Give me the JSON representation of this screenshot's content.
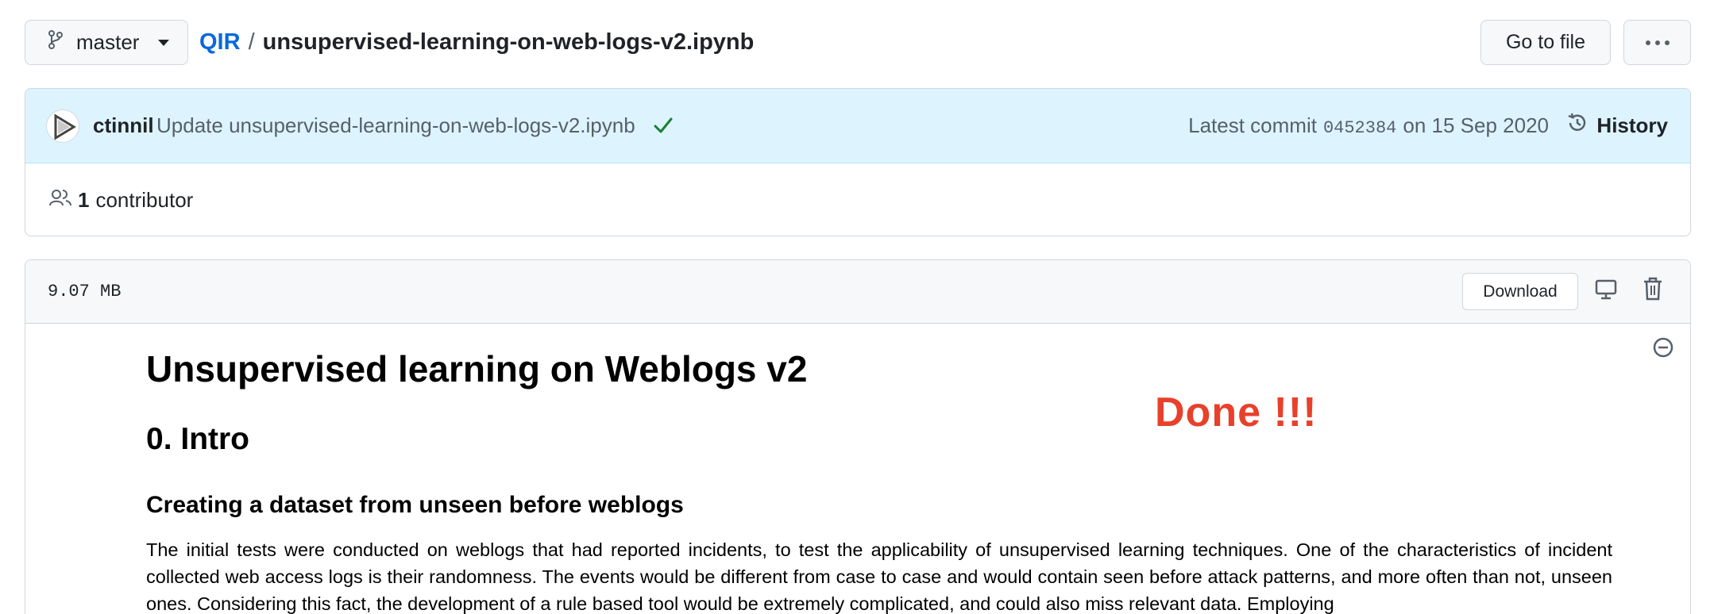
{
  "branch": {
    "label": "master",
    "icon": "git-branch-icon"
  },
  "breadcrumb": {
    "repo": "QIR",
    "separator": "/",
    "file": "unsupervised-learning-on-web-logs-v2.ipynb"
  },
  "actions": {
    "goto_file": "Go to file",
    "more": "more-horizontal-icon"
  },
  "commit": {
    "author": "ctinnil",
    "message": "Update unsupervised-learning-on-web-logs-v2.ipynb",
    "status_icon": "check-icon",
    "latest_prefix": "Latest commit",
    "sha": "0452384",
    "date_text": "on 15 Sep 2020",
    "history_label": "History"
  },
  "contributors": {
    "count": "1",
    "label": "contributor"
  },
  "file": {
    "size": "9.07 MB",
    "download_label": "Download"
  },
  "notebook": {
    "title": "Unsupervised learning on Weblogs v2",
    "h2": "0. Intro",
    "h3": "Creating a dataset from unseen before weblogs",
    "paragraph": "The initial tests were conducted on weblogs that had reported incidents, to test the applicability of unsupervised learning techniques. One of the characteristics of incident collected web access logs is their randomness. The events would be different from case to case and would contain seen before attack patterns, and more often than not, unseen ones. Considering this fact, the development of a rule based tool would be extremely complicated, and could also miss relevant data. Employing"
  },
  "overlay": {
    "done_text": "Done !!!"
  },
  "colors": {
    "link": "#0969da",
    "overlay": "#e8402a",
    "success": "#1a7f37",
    "commit_bg": "#ddf4ff"
  }
}
